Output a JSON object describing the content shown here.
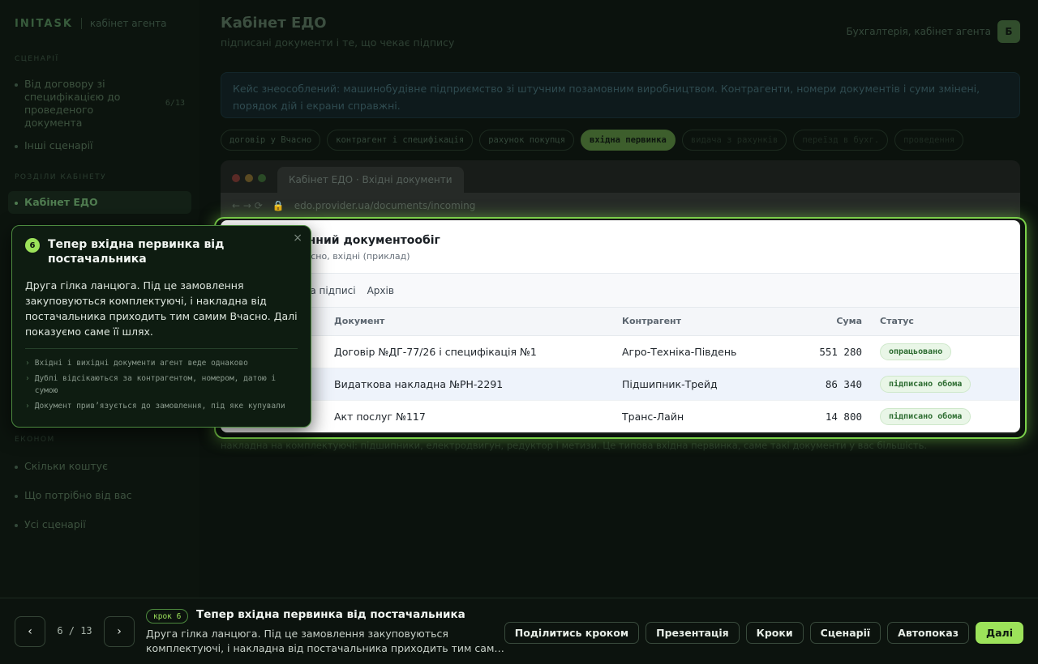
{
  "sidebar": {
    "brand": "INITASK",
    "brand_sub": "кабінет агента",
    "section_scenarios": "СЦЕНАРІЇ",
    "scenario_main": "Від договору зі специфікацією до проведеного документа",
    "scenario_count": "6/13",
    "scenario_other": "Інші сценарії",
    "section_sections": "РОЗДІЛИ КАБІНЕТУ",
    "active_item": "Кабінет ЕДО",
    "section_more": "ЕКОНОМ",
    "more_items": [
      "Скільки коштує",
      "Що потрібно від вас",
      "Усі сценарії"
    ]
  },
  "header": {
    "title": "Кабінет ЕДО",
    "subtitle": "підписані документи і те, що чекає підпису",
    "user": "Бухгалтерія, кабінет агента",
    "avatar": "Б"
  },
  "notice": "Кейс знеособлений: машинобудівне підприємство зі штучним позамовним виробництвом. Контрагенти, номери документів і суми змінені, порядок дій і екрани справжні.",
  "chips": [
    {
      "label": "договір у Вчасно",
      "state": "normal"
    },
    {
      "label": "контрагент і специфікація",
      "state": "normal"
    },
    {
      "label": "рахунок покупця",
      "state": "normal"
    },
    {
      "label": "вхідна первинка",
      "state": "active"
    },
    {
      "label": "видача з рахунків",
      "state": "dim"
    },
    {
      "label": "переїзд в бухг.",
      "state": "dim"
    },
    {
      "label": "проведення",
      "state": "dim"
    }
  ],
  "browser": {
    "tab_title": "Кабінет ЕДО · Вхідні документи",
    "url": "edo.provider.ua/documents/incoming"
  },
  "edo": {
    "title": "онний документообіг",
    "subtitle": "часно, вхідні (приклад)",
    "tabs": [
      "і",
      "На підписі",
      "Архів"
    ],
    "columns": {
      "doc": "Документ",
      "counterparty": "Контрагент",
      "sum": "Сума",
      "status": "Статус"
    },
    "rows": [
      {
        "doc": "Договір №ДГ-77/26 і специфікація №1",
        "counterparty": "Агро-Техніка-Південь",
        "sum": "551 280",
        "status": "опрацьовано"
      },
      {
        "doc": "Видаткова накладна №РН-2291",
        "counterparty": "Підшипник-Трейд",
        "sum": "86 340",
        "status": "підписано обома"
      },
      {
        "doc": "Акт послуг №117",
        "counterparty": "Транс-Лайн",
        "sum": "14 800",
        "status": "підписано обома"
      }
    ]
  },
  "below_text": "накладна на комплектуючі: підшипники, електродвигун, редуктор і метизи. Це типова вхідна первинка, саме такі документи у вас більшість.",
  "tooltip": {
    "num": "6",
    "title": "Тепер вхідна первинка від постачальника",
    "body": "Друга гілка ланцюга. Під це замовлення закуповуються комплектуючі, і накладна від постачальника приходить тим самим Вчасно. Далі показуємо саме її шлях.",
    "points": [
      "Вхідні і вихідні документи агент веде однаково",
      "Дублі відсікаються за контрагентом, номером, датою і сумою",
      "Документ прив’язується до замовлення, під яке купували"
    ],
    "close": "×"
  },
  "bottom": {
    "prev": "‹",
    "next": "›",
    "counter": "6 / 13",
    "step_badge": "крок 6",
    "step_title": "Тепер вхідна первинка від постачальника",
    "step_desc": "Друга гілка ланцюга. Під це замовлення закуповуються комплектуючі, і накладна від постачальника приходить тим сам…",
    "actions": [
      "Поділитись кроком",
      "Презентація",
      "Кроки",
      "Сценарії",
      "Автопоказ"
    ],
    "primary": "Далі"
  }
}
